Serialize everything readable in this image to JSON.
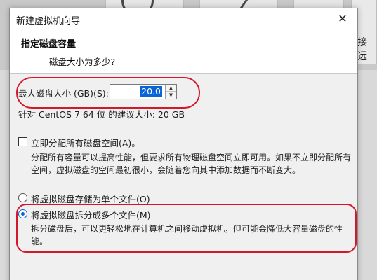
{
  "background": {
    "partial_label": "接远"
  },
  "dialog": {
    "title": "新建虚拟机向导",
    "close_glyph": "✕",
    "header_title": "指定磁盘容量",
    "header_subtitle": "磁盘大小为多少?"
  },
  "disk_size": {
    "label": "最大磁盘大小 (GB)(S):",
    "value": "20.0",
    "recommendation": "针对 CentOS 7 64 位 的建议大小: 20 GB"
  },
  "allocate_now": {
    "label": "立即分配所有磁盘空间(A)。",
    "checked": false,
    "description": "分配所有容量可以提高性能，但要求所有物理磁盘空间立即可用。如果不立即分配所有空间，虚拟磁盘的空间最初很小，会随着您向其中添加数据而不断变大。"
  },
  "storage_options": [
    {
      "label": "将虚拟磁盘存储为单个文件(O)",
      "selected": false
    },
    {
      "label": "将虚拟磁盘拆分成多个文件(M)",
      "selected": true,
      "description": "拆分磁盘后，可以更轻松地在计算机之间移动虚拟机，但可能会降低大容量磁盘的性能。"
    }
  ],
  "colors": {
    "highlight_ring": "#d4182c",
    "selection": "#0a64d6"
  }
}
